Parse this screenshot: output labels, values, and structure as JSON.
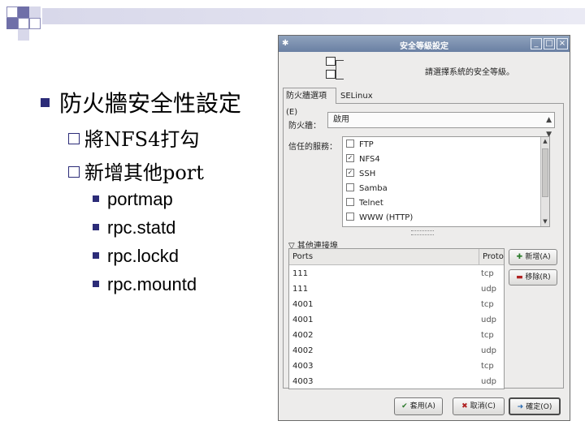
{
  "slide": {
    "title": "防火牆安全性設定",
    "sub_items": [
      "將NFS4打勾",
      "新增其他port"
    ],
    "ports": [
      "portmap",
      "rpc.statd",
      "rpc.lockd",
      "rpc.mountd"
    ]
  },
  "dialog": {
    "title": "安全等級設定",
    "header_text": "請選擇系統的安全等級。",
    "tabs": [
      "防火牆選項(E)",
      "SELinux"
    ],
    "firewall_label": "防火牆：",
    "firewall_value": "啟用",
    "trusted_label": "信任的服務：",
    "services": [
      {
        "name": "FTP",
        "checked": false
      },
      {
        "name": "NFS4",
        "checked": true
      },
      {
        "name": "SSH",
        "checked": true
      },
      {
        "name": "Samba",
        "checked": false
      },
      {
        "name": "Telnet",
        "checked": false
      },
      {
        "name": "WWW (HTTP)",
        "checked": false
      }
    ],
    "other_ports_label": "其他連接埠",
    "ports_header": "Ports",
    "proto_header": "Proto",
    "port_rows": [
      {
        "port": "111",
        "proto": "tcp"
      },
      {
        "port": "111",
        "proto": "udp"
      },
      {
        "port": "4001",
        "proto": "tcp"
      },
      {
        "port": "4001",
        "proto": "udp"
      },
      {
        "port": "4002",
        "proto": "tcp"
      },
      {
        "port": "4002",
        "proto": "udp"
      },
      {
        "port": "4003",
        "proto": "tcp"
      },
      {
        "port": "4003",
        "proto": "udp"
      }
    ],
    "add_label": "新增(A)",
    "remove_label": "移除(R)",
    "apply_label": "套用(A)",
    "cancel_label": "取消(C)",
    "ok_label": "確定(O)"
  },
  "icons": {
    "window_menu": "window-menu-icon",
    "expander": "expander-down-icon",
    "add": "plus-icon",
    "remove": "minus-icon",
    "apply": "check-icon",
    "cancel": "x-icon",
    "ok": "ok-icon"
  },
  "colors": {
    "slide_accent": "#2c2c78",
    "titlebar": "#7a8fb0",
    "dialog_bg": "#edeceb"
  }
}
